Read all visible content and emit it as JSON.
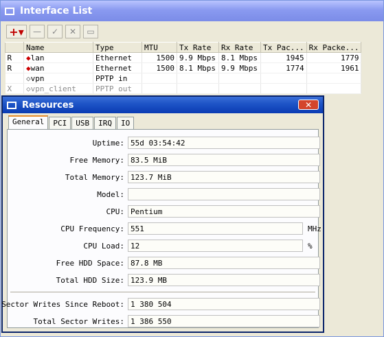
{
  "interface_window": {
    "title": "Interface List",
    "toolbar": {
      "add_label": "+▾",
      "remove_label": "—",
      "enable_label": "✓",
      "disable_label": "✕",
      "comment_label": "▭"
    },
    "columns": [
      "",
      "Name",
      "Type",
      "MTU",
      "Tx Rate",
      "Rx Rate",
      "Tx Pac...",
      "Rx Packe..."
    ],
    "rows": [
      {
        "flag": "R",
        "name": "lan",
        "type": "Ethernet",
        "mtu": "1500",
        "tx_rate": "9.9 Mbps",
        "rx_rate": "8.1 Mbps",
        "tx_packets": "1945",
        "rx_packets": "1779"
      },
      {
        "flag": "R",
        "name": "wan",
        "type": "Ethernet",
        "mtu": "1500",
        "tx_rate": "8.1 Mbps",
        "rx_rate": "9.9 Mbps",
        "tx_packets": "1774",
        "rx_packets": "1961"
      },
      {
        "flag": "",
        "name": "vpn",
        "type": "PPTP in",
        "mtu": "",
        "tx_rate": "",
        "rx_rate": "",
        "tx_packets": "",
        "rx_packets": ""
      },
      {
        "flag": "X",
        "name": "vpn_client",
        "type": "PPTP out",
        "mtu": "",
        "tx_rate": "",
        "rx_rate": "",
        "tx_packets": "",
        "rx_packets": ""
      }
    ]
  },
  "resources_window": {
    "title": "Resources",
    "close_label": "✕",
    "tabs": [
      "General",
      "PCI",
      "USB",
      "IRQ",
      "IO"
    ],
    "fields": {
      "uptime": {
        "label": "Uptime:",
        "value": "55d 03:54:42"
      },
      "free_memory": {
        "label": "Free Memory:",
        "value": "83.5 MiB"
      },
      "total_memory": {
        "label": "Total Memory:",
        "value": "123.7 MiB"
      },
      "model": {
        "label": "Model:",
        "value": ""
      },
      "cpu": {
        "label": "CPU:",
        "value": "Pentium"
      },
      "cpu_frequency": {
        "label": "CPU Frequency:",
        "value": "551",
        "unit": "MHz"
      },
      "cpu_load": {
        "label": "CPU Load:",
        "value": "12",
        "unit": "%"
      },
      "free_hdd": {
        "label": "Free HDD Space:",
        "value": "87.8 MB"
      },
      "total_hdd": {
        "label": "Total HDD Size:",
        "value": "123.9 MB"
      },
      "sector_writes_reboot": {
        "label": "Sector Writes Since Reboot:",
        "value": "1 380 504"
      },
      "total_sector_writes": {
        "label": "Total Sector Writes:",
        "value": "1 386 550"
      }
    }
  },
  "colors": {
    "title_active": "#0a3bb3",
    "title_inactive": "#8a9af0",
    "tab_highlight": "#e68b2c",
    "close_button": "#d4452c"
  }
}
